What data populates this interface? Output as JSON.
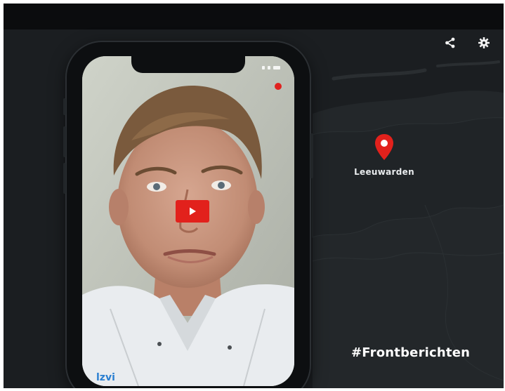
{
  "video": {
    "location_label": "Leeuwarden",
    "hashtag": "#Frontberichten"
  },
  "controls": {
    "share_icon": "share-icon",
    "settings_icon": "gear-icon",
    "play_icon": "play-icon"
  },
  "colors": {
    "accent": "#e2211c",
    "background": "#1b1e21",
    "topbar": "#0b0c0e"
  }
}
